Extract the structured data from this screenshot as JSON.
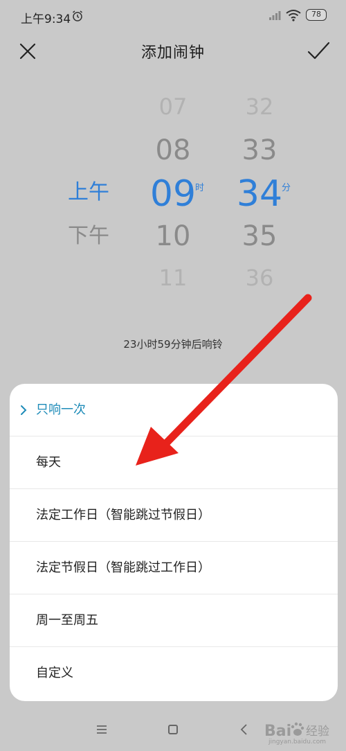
{
  "status_bar": {
    "time": "上午9:34",
    "battery": "78",
    "icons": [
      "alarm-icon",
      "signal-icon",
      "wifi-icon",
      "battery-icon"
    ]
  },
  "header": {
    "title": "添加闹钟",
    "close_icon": "close-icon",
    "confirm_icon": "check-icon"
  },
  "picker": {
    "ampm": [
      "上午",
      "下午"
    ],
    "ampm_selected": "上午",
    "hours": [
      "07",
      "08",
      "09",
      "10",
      "11"
    ],
    "hour_selected": "09",
    "hour_unit": "时",
    "minutes": [
      "32",
      "33",
      "34",
      "35",
      "36"
    ],
    "minute_selected": "34",
    "minute_unit": "分",
    "countdown": "23小时59分钟后响铃"
  },
  "repeat_options": [
    {
      "label": "只响一次",
      "selected": true
    },
    {
      "label": "每天",
      "selected": false
    },
    {
      "label": "法定工作日（智能跳过节假日）",
      "selected": false
    },
    {
      "label": "法定节假日（智能跳过工作日）",
      "selected": false
    },
    {
      "label": "周一至周五",
      "selected": false
    },
    {
      "label": "自定义",
      "selected": false
    }
  ],
  "nav_bar": {
    "icons": [
      "menu-icon",
      "home-icon",
      "back-icon"
    ]
  },
  "watermark": {
    "text": "Bai",
    "text2": "经验",
    "sub": "jingyan.baidu.com"
  },
  "colors": {
    "accent": "#2f7fd8",
    "selected_option": "#1d8bb8",
    "arrow": "#e8221b",
    "backdrop": "#c9c9c9"
  }
}
